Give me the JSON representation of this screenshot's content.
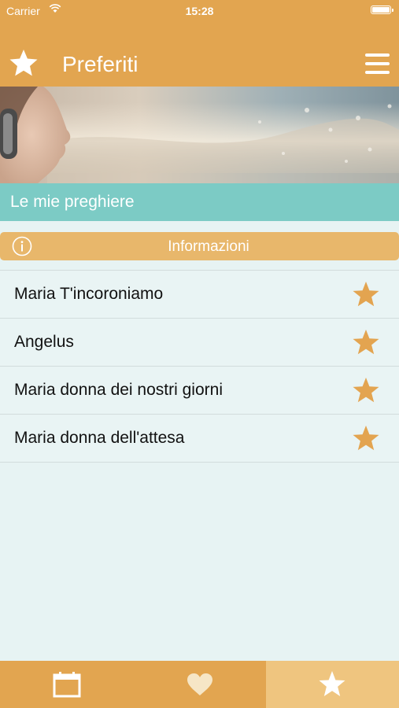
{
  "status_bar": {
    "carrier": "Carrier",
    "time": "15:28"
  },
  "nav": {
    "title": "Preferiti",
    "left_icon": "star-icon",
    "right_icon": "menu-icon"
  },
  "section": {
    "title": "Le mie preghiere"
  },
  "info": {
    "label": "Informazioni"
  },
  "favorites": [
    {
      "title": "Maria T'incoroniamo"
    },
    {
      "title": "Angelus"
    },
    {
      "title": "Maria donna dei nostri giorni"
    },
    {
      "title": "Maria donna dell'attesa"
    }
  ],
  "tabs": [
    {
      "icon": "calendar-icon",
      "active": false
    },
    {
      "icon": "heart-icon",
      "active": false
    },
    {
      "icon": "star-icon",
      "active": true
    }
  ],
  "colors": {
    "header": "#e2a550",
    "section": "#7ccbc5",
    "info_bar": "#e8b76b",
    "list_bg": "#e9f4f4",
    "star": "#e3a450"
  }
}
